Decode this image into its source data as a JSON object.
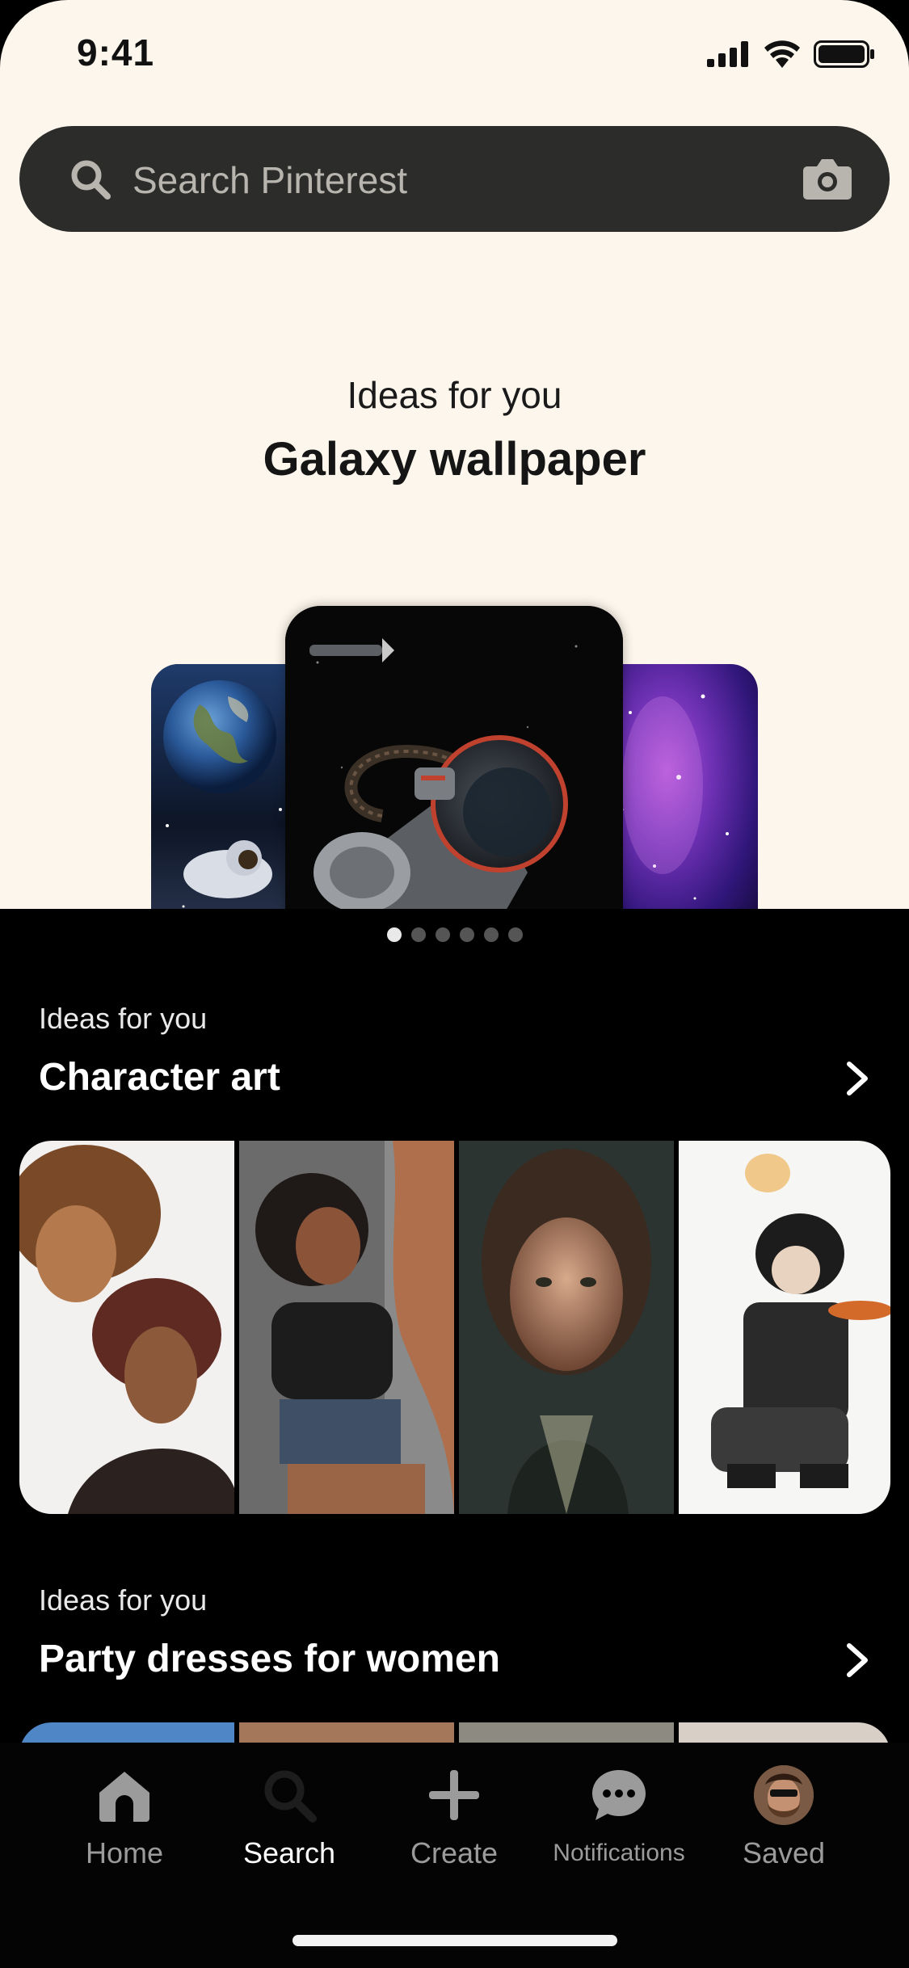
{
  "status_bar": {
    "time": "9:41"
  },
  "search": {
    "placeholder": "Search Pinterest"
  },
  "hero": {
    "subtitle": "Ideas for you",
    "title": "Galaxy wallpaper",
    "carousel_pages": 6,
    "active_page": 1
  },
  "sections": [
    {
      "label": "Ideas for you",
      "title": "Character art"
    },
    {
      "label": "Ideas for you",
      "title": "Party dresses for women"
    }
  ],
  "tab_bar": {
    "items": [
      {
        "label": "Home",
        "icon": "home-icon"
      },
      {
        "label": "Search",
        "icon": "search-icon"
      },
      {
        "label": "Create",
        "icon": "plus-icon"
      },
      {
        "label": "Notifications",
        "icon": "chat-bubble-icon"
      },
      {
        "label": "Saved",
        "icon": "avatar"
      }
    ],
    "active": "Search"
  },
  "colors": {
    "hero_background": "#fdf6ec",
    "search_background": "#2c2c2b",
    "page_background": "#000000",
    "tab_active": "#ffffff",
    "tab_inactive": "#9b9b9b"
  }
}
